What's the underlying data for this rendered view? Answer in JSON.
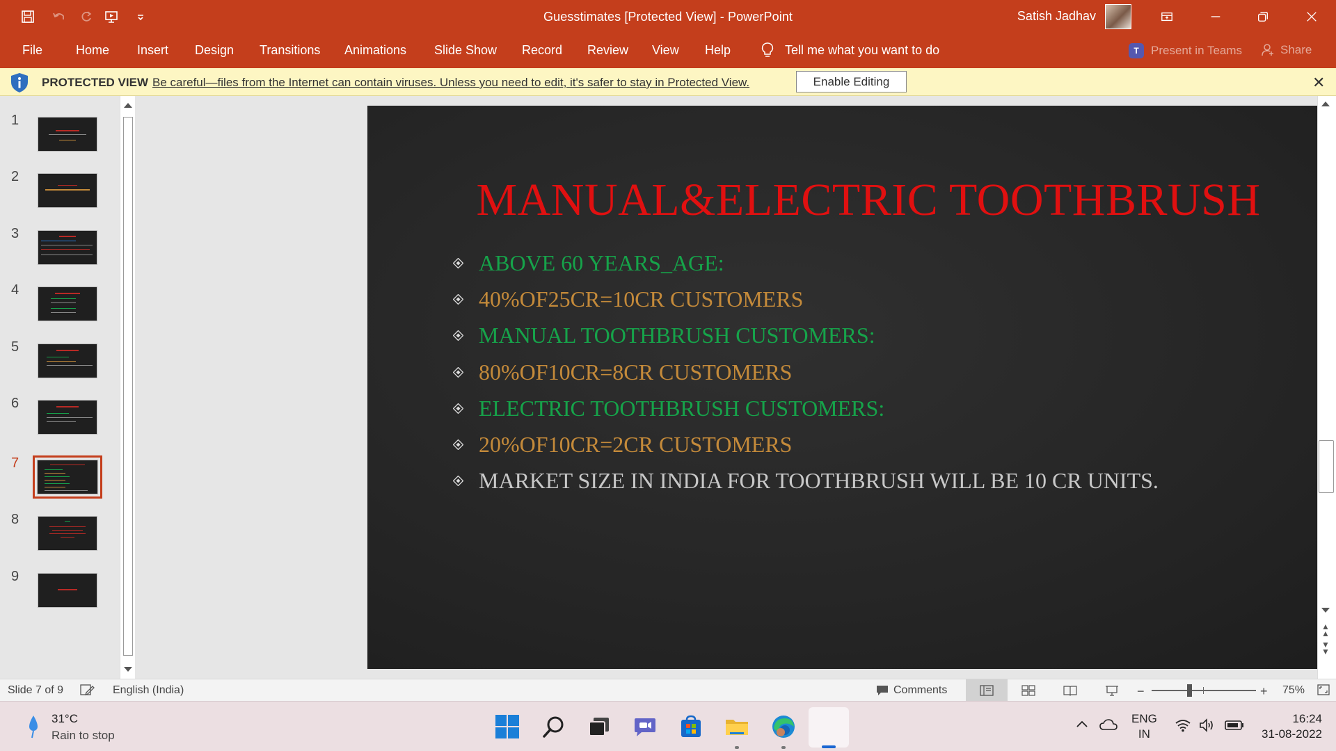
{
  "titlebar": {
    "document_title": "Guesstimates [Protected View]  -  PowerPoint",
    "user_name": "Satish Jadhav",
    "accent": "#c43e1c"
  },
  "ribbon": {
    "tabs": [
      "File",
      "Home",
      "Insert",
      "Design",
      "Transitions",
      "Animations",
      "Slide Show",
      "Record",
      "Review",
      "View",
      "Help"
    ],
    "tell_me": "Tell me what you want to do",
    "present_in_teams": "Present in Teams",
    "share": "Share"
  },
  "protected_view": {
    "title": "PROTECTED VIEW",
    "message": "Be careful—files from the Internet can contain viruses. Unless you need to edit, it's safer to stay in Protected View.",
    "enable_button": "Enable Editing",
    "background": "#fdf6c3"
  },
  "thumbnails": {
    "numbers": [
      "1",
      "2",
      "3",
      "4",
      "5",
      "6",
      "7",
      "8",
      "9"
    ],
    "selected": "7"
  },
  "slide": {
    "title": "MANUAL&ELECTRIC TOOTHBRUSH",
    "title_color": "#e01010",
    "bullets": [
      {
        "text": "ABOVE 60 YEARS_AGE:",
        "color": "#16a34a"
      },
      {
        "text": "40%OF25CR=10CR CUSTOMERS",
        "color": "#c48a3a"
      },
      {
        "text": "MANUAL TOOTHBRUSH CUSTOMERS:",
        "color": "#16a34a"
      },
      {
        "text": "80%OF10CR=8CR CUSTOMERS",
        "color": "#c48a3a"
      },
      {
        "text": "ELECTRIC TOOTHBRUSH CUSTOMERS:",
        "color": "#16a34a"
      },
      {
        "text": "20%OF10CR=2CR CUSTOMERS",
        "color": "#c48a3a"
      },
      {
        "text": "MARKET SIZE IN INDIA FOR  TOOTHBRUSH WILL BE 10 CR UNITS.",
        "color": "#c8c8c8"
      }
    ]
  },
  "statusbar": {
    "slide_counter": "Slide 7 of 9",
    "language": "English (India)",
    "comments": "Comments",
    "zoom": "75%"
  },
  "taskbar": {
    "temperature": "31°C",
    "weather": "Rain to stop",
    "lang_top": "ENG",
    "lang_bottom": "IN",
    "time": "16:24",
    "date": "31-08-2022"
  }
}
